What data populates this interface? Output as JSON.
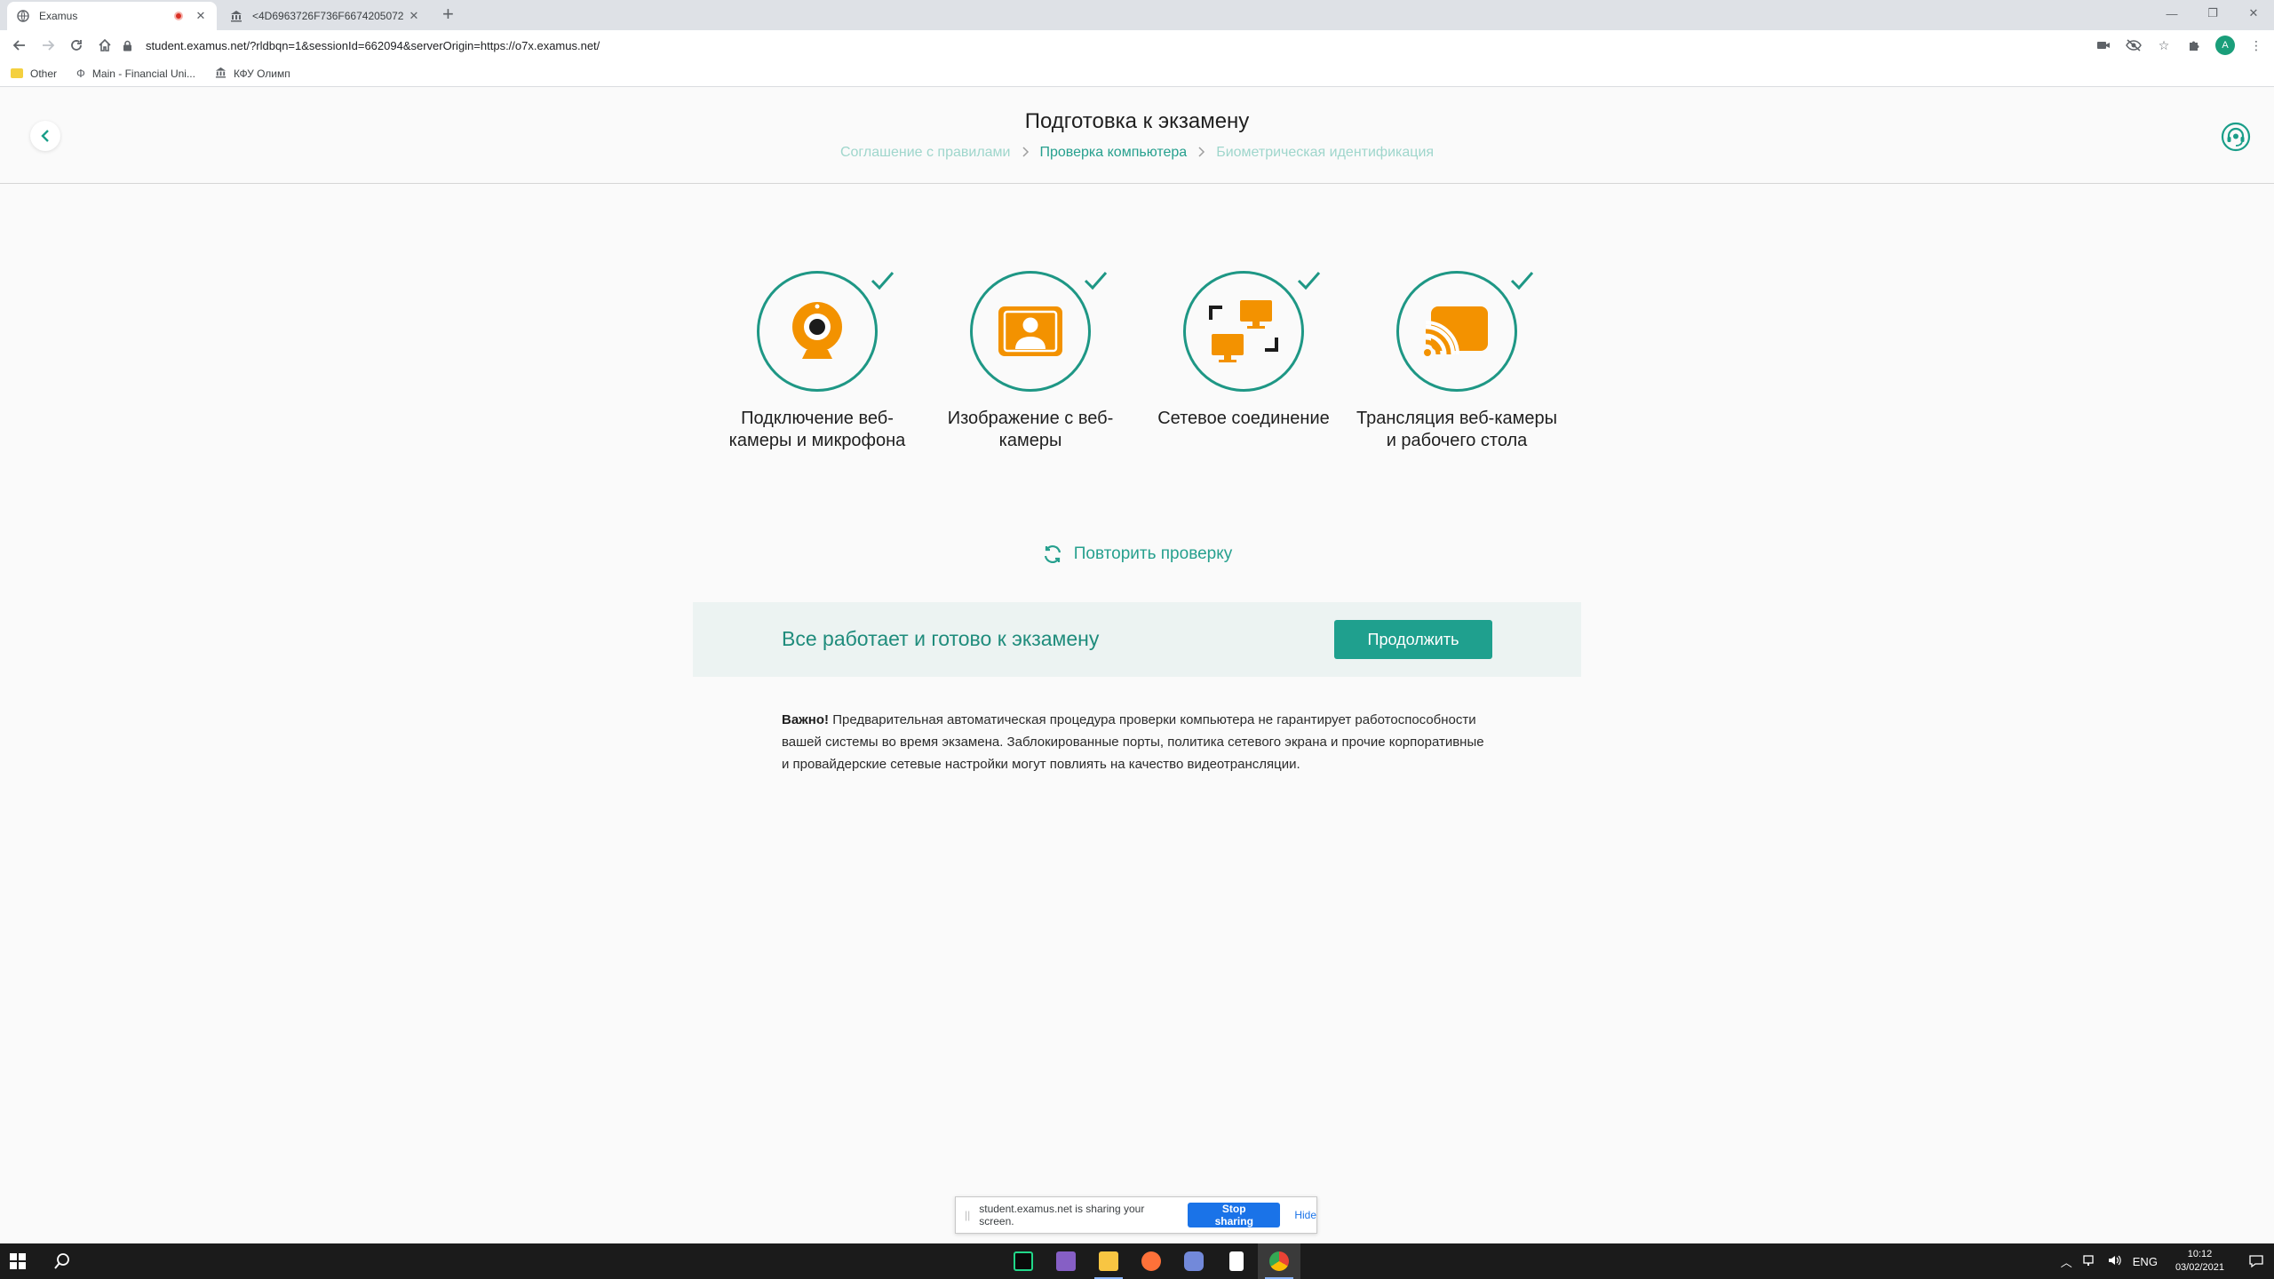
{
  "browser": {
    "tabs": [
      {
        "title": "Examus",
        "recording": true,
        "favicon": "globe-icon"
      },
      {
        "title": "<4D6963726F736F6674205072",
        "favicon": "bank-icon"
      }
    ],
    "url": "student.examus.net/?rldbqn=1&sessionId=662094&serverOrigin=https://o7x.examus.net/",
    "profile_initial": "A",
    "bookmarks": [
      {
        "label": "Other",
        "icon": "folder-icon"
      },
      {
        "label": "Main - Financial Uni...",
        "icon": "phi-icon"
      },
      {
        "label": "КФУ Олимп",
        "icon": "bank-icon"
      }
    ]
  },
  "header": {
    "title": "Подготовка к экзамену",
    "steps": [
      {
        "label": "Соглашение с правилами",
        "state": "done"
      },
      {
        "label": "Проверка компьютера",
        "state": "current"
      },
      {
        "label": "Биометрическая идентификация",
        "state": "pending"
      }
    ]
  },
  "checks": [
    {
      "label": "Подключение веб-камеры и микрофона",
      "icon": "webcam-icon",
      "passed": true
    },
    {
      "label": "Изображение с веб-камеры",
      "icon": "user-portrait-icon",
      "passed": true
    },
    {
      "label": "Сетевое соединение",
      "icon": "network-icon",
      "passed": true
    },
    {
      "label": "Трансляция веб-камеры и рабочего стола",
      "icon": "cast-icon",
      "passed": true
    }
  ],
  "retry_label": "Повторить проверку",
  "banner": {
    "message": "Все работает и готово к экзамену",
    "button": "Продолжить"
  },
  "note": {
    "lead": "Важно!",
    "text": " Предварительная автоматическая процедура проверки компьютера не гарантирует работоспособности вашей системы во время экзамена. Заблокированные порты, политика сетевого экрана и прочие корпоративные и провайдерские сетевые настройки могут повлиять на качество видеотрансляции."
  },
  "sharebar": {
    "text": "student.examus.net is sharing your screen.",
    "stop": "Stop sharing",
    "hide": "Hide"
  },
  "taskbar": {
    "apps": [
      "pycharm-icon",
      "visual-studio-icon",
      "file-explorer-icon",
      "firefox-icon",
      "discord-icon",
      "notepad-icon",
      "chrome-icon"
    ],
    "language": "ENG",
    "time": "10:12",
    "date": "03/02/2021"
  },
  "colors": {
    "accent": "#1fa08e",
    "icon_orange": "#f39200",
    "ring": "#1e9785"
  }
}
